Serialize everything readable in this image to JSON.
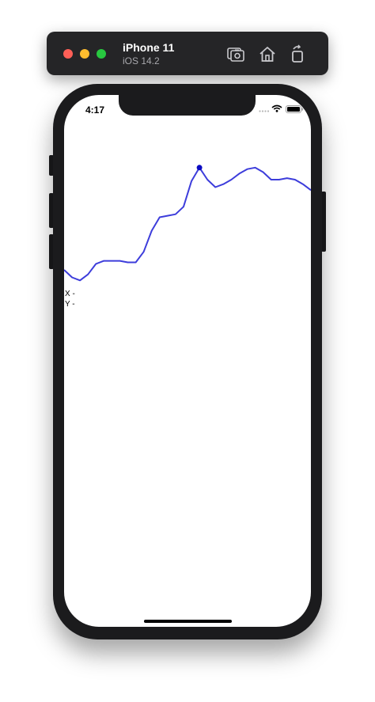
{
  "simulator": {
    "device_name": "iPhone 11",
    "os_version": "iOS 14.2",
    "icons": [
      "screenshot-icon",
      "home-icon",
      "rotate-icon"
    ]
  },
  "status_bar": {
    "time": "4:17",
    "icons": [
      "signal-icon",
      "wifi-icon",
      "battery-icon"
    ]
  },
  "readout": {
    "x": "X -",
    "y": "Y -"
  },
  "colors": {
    "line": "#3d3ddb",
    "marker": "#0b0bc2"
  },
  "chart_data": {
    "type": "line",
    "series": [
      {
        "values": [
          10,
          5,
          3,
          7,
          14,
          16,
          16,
          16,
          15,
          15,
          22,
          36,
          45,
          46,
          47,
          52,
          69,
          78,
          70,
          65,
          67,
          70,
          74,
          77,
          78,
          75,
          70,
          70,
          71,
          70,
          67,
          63
        ]
      }
    ],
    "highlighted_index": 17
  }
}
